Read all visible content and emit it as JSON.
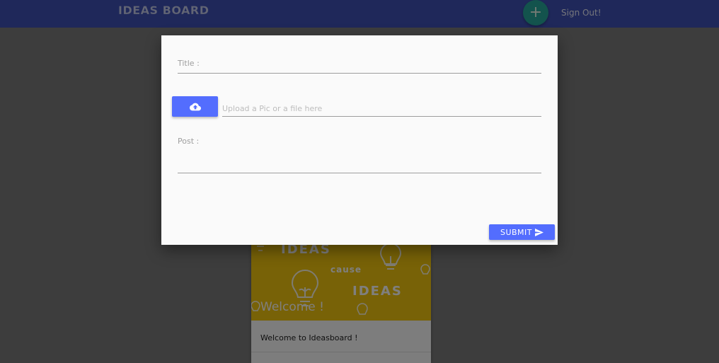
{
  "navbar": {
    "brand": "IDEAS BOARD",
    "fab_label": "+",
    "signout_label": "Sign Out!"
  },
  "card": {
    "image_words": [
      "IDEAS",
      "cause",
      "IDEAS"
    ],
    "title": "Welcome !",
    "text": "Welcome to Ideasboard !"
  },
  "modal": {
    "title_label": "Title :",
    "title_value": "",
    "upload_icon": "cloud-upload-icon",
    "file_placeholder": "Upload a Pic or a file here",
    "post_label": "Post :",
    "post_value": "",
    "submit_label": "SUBMIT",
    "submit_icon": "send-icon"
  },
  "colors": {
    "navbar": "#3f51b5",
    "fab": "#26a69a",
    "accent_button": "#536dfe",
    "card_image": "#f1c40f"
  }
}
